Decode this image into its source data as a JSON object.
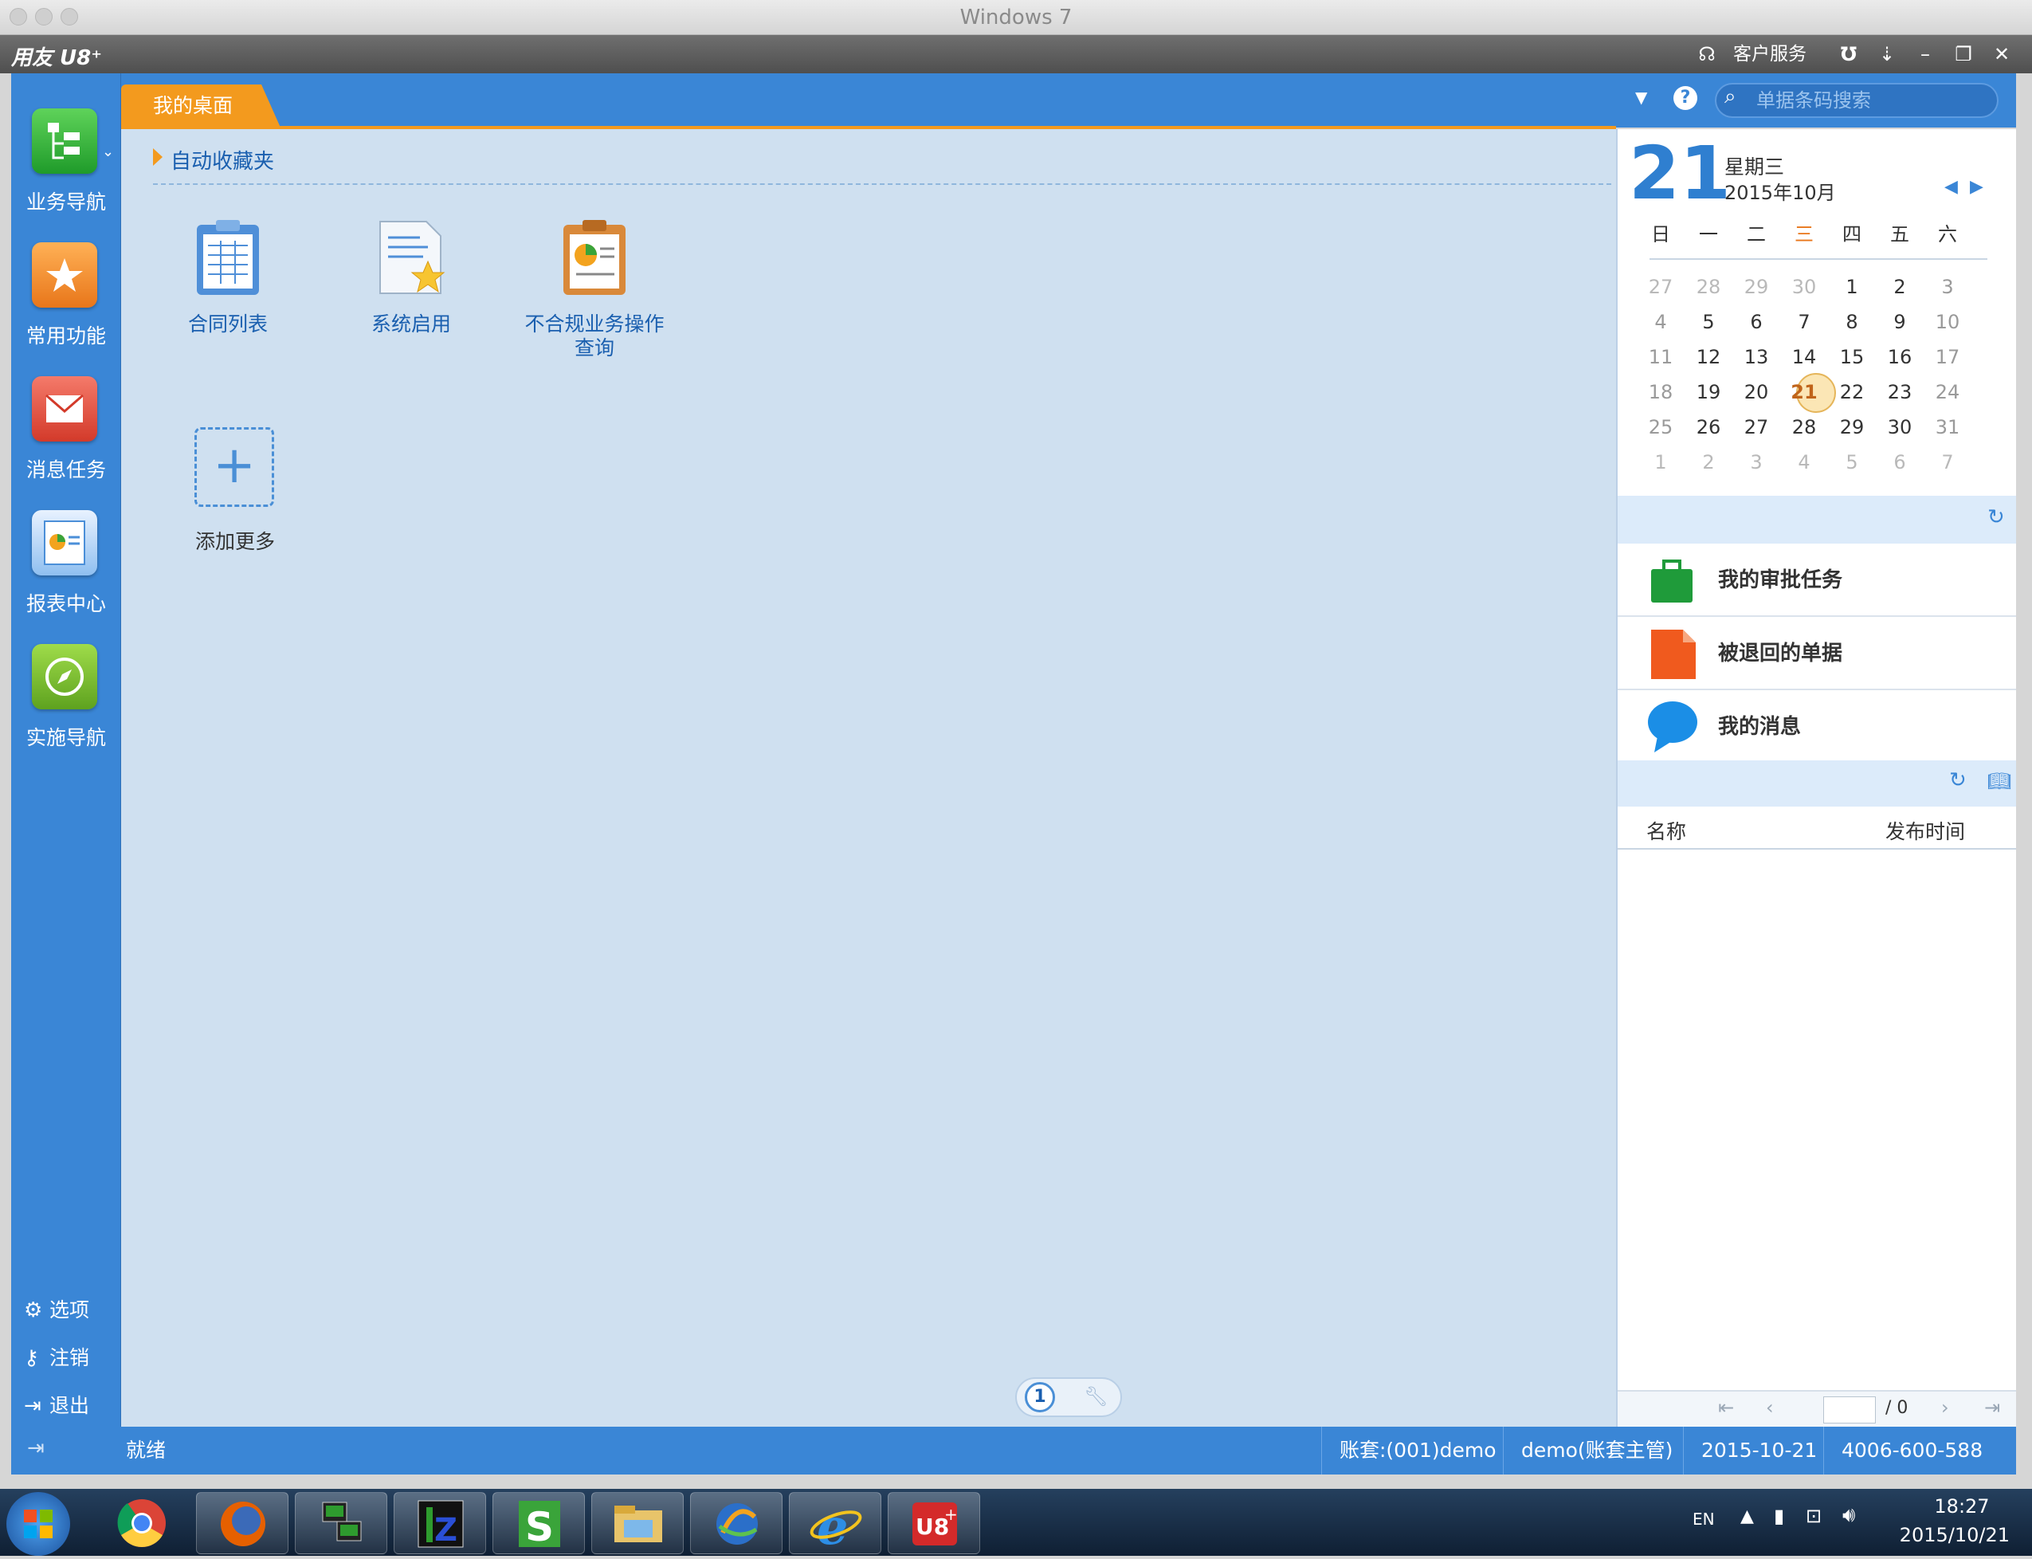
{
  "window": {
    "title": "Windows 7"
  },
  "app": {
    "brand": "用友 U8⁺",
    "customer_service": "客户服务",
    "topbar_icons": [
      "u-icon",
      "dropdown-arrow-icon",
      "minimize-icon",
      "restore-icon",
      "close-icon"
    ]
  },
  "sidebar": {
    "items": [
      {
        "label": "业务导航",
        "icon": "business-nav-icon",
        "color": "#2fae3a"
      },
      {
        "label": "常用功能",
        "icon": "favorites-icon",
        "color": "#f08a24"
      },
      {
        "label": "消息任务",
        "icon": "message-icon",
        "color": "#e24a3a"
      },
      {
        "label": "报表中心",
        "icon": "report-icon",
        "color": "#5aa0e6"
      },
      {
        "label": "实施导航",
        "icon": "compass-icon",
        "color": "#6fbd2a"
      }
    ],
    "bottom": [
      {
        "label": "选项",
        "icon": "gear-icon"
      },
      {
        "label": "注销",
        "icon": "key-icon"
      },
      {
        "label": "退出",
        "icon": "exit-icon"
      }
    ]
  },
  "tab": {
    "label": "我的桌面"
  },
  "search": {
    "placeholder": "单据条码搜索"
  },
  "desktop": {
    "favorites_title": "自动收藏夹",
    "shortcuts": [
      {
        "label": "合同列表",
        "icon": "contract-list-icon"
      },
      {
        "label": "系统启用",
        "icon": "system-enable-icon"
      },
      {
        "label": "不合规业务操作查询",
        "icon": "noncompliance-query-icon"
      }
    ],
    "add_more": "添加更多",
    "page": "1"
  },
  "calendar": {
    "day": "21",
    "weekday": "星期三",
    "month_year": "2015年10月",
    "headers": [
      "日",
      "一",
      "二",
      "三",
      "四",
      "五",
      "六"
    ],
    "highlight_header_index": 3,
    "weeks": [
      [
        "27",
        "28",
        "29",
        "30",
        "1",
        "2",
        "3"
      ],
      [
        "4",
        "5",
        "6",
        "7",
        "8",
        "9",
        "10"
      ],
      [
        "11",
        "12",
        "13",
        "14",
        "15",
        "16",
        "17"
      ],
      [
        "18",
        "19",
        "20",
        "21",
        "22",
        "23",
        "24"
      ],
      [
        "25",
        "26",
        "27",
        "28",
        "29",
        "30",
        "31"
      ],
      [
        "1",
        "2",
        "3",
        "4",
        "5",
        "6",
        "7"
      ]
    ],
    "today": "21"
  },
  "tasks": [
    {
      "label": "我的审批任务",
      "icon": "briefcase-icon",
      "color": "#1f9b3a"
    },
    {
      "label": "被退回的单据",
      "icon": "document-icon",
      "color": "#f05a1e"
    },
    {
      "label": "我的消息",
      "icon": "speech-bubble-icon",
      "color": "#1b8ee6"
    }
  ],
  "notices": {
    "col_name": "名称",
    "col_time": "发布时间",
    "page_of": "/ 0"
  },
  "status": {
    "state": "就绪",
    "account": "账套:(001)demo",
    "user": "demo(账套主管)",
    "date": "2015-10-21",
    "phone": "4006-600-588"
  },
  "taskbar": {
    "apps": [
      "windows-start-icon",
      "chrome-icon",
      "firefox-icon",
      "network-icon",
      "cpu-z-icon",
      "s-app-icon",
      "file-explorer-icon",
      "media-icon",
      "internet-explorer-icon",
      "u8-icon"
    ],
    "lang": "EN",
    "time": "18:27",
    "date": "2015/10/21"
  }
}
